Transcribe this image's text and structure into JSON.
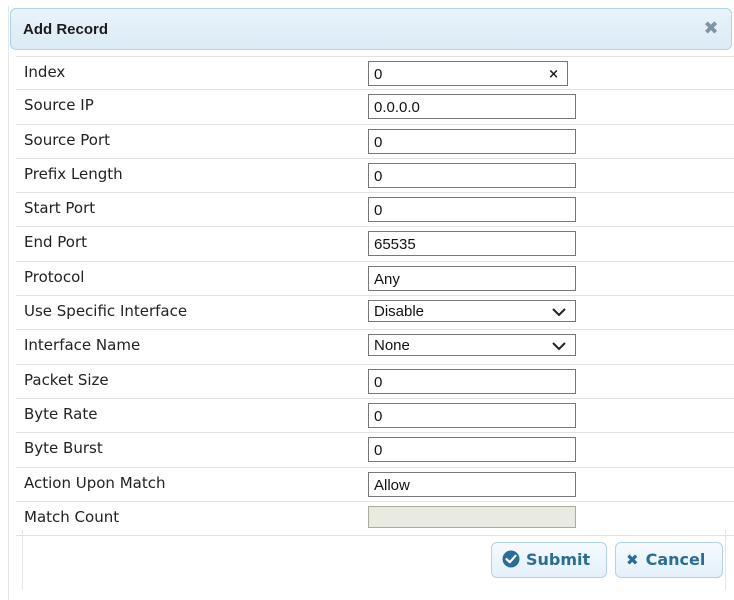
{
  "dialog": {
    "title": "Add Record",
    "close_glyph": "✖"
  },
  "fields": [
    {
      "label": "Index",
      "value": "0",
      "type": "text-clearable"
    },
    {
      "label": "Source IP",
      "value": "0.0.0.0",
      "type": "text"
    },
    {
      "label": "Source Port",
      "value": "0",
      "type": "text"
    },
    {
      "label": "Prefix Length",
      "value": "0",
      "type": "text"
    },
    {
      "label": "Start Port",
      "value": "0",
      "type": "text"
    },
    {
      "label": "End Port",
      "value": "65535",
      "type": "text"
    },
    {
      "label": "Protocol",
      "value": "Any",
      "type": "text"
    },
    {
      "label": "Use Specific Interface",
      "value": "Disable",
      "type": "select"
    },
    {
      "label": "Interface Name",
      "value": "None",
      "type": "select"
    },
    {
      "label": "Packet Size",
      "value": "0",
      "type": "text"
    },
    {
      "label": "Byte Rate",
      "value": "0",
      "type": "text"
    },
    {
      "label": "Byte Burst",
      "value": "0",
      "type": "text"
    },
    {
      "label": "Action Upon Match",
      "value": "Allow",
      "type": "text"
    },
    {
      "label": "Match Count",
      "value": "",
      "type": "readonly"
    }
  ],
  "buttons": {
    "submit_label": "Submit",
    "cancel_label": "Cancel",
    "cancel_glyph": "✖"
  },
  "colors": {
    "accent": "#2b6d96",
    "titlebar_border": "#aed3ea",
    "close_icon": "#7f94a3",
    "readonly_bg": "#e9ebe1"
  }
}
